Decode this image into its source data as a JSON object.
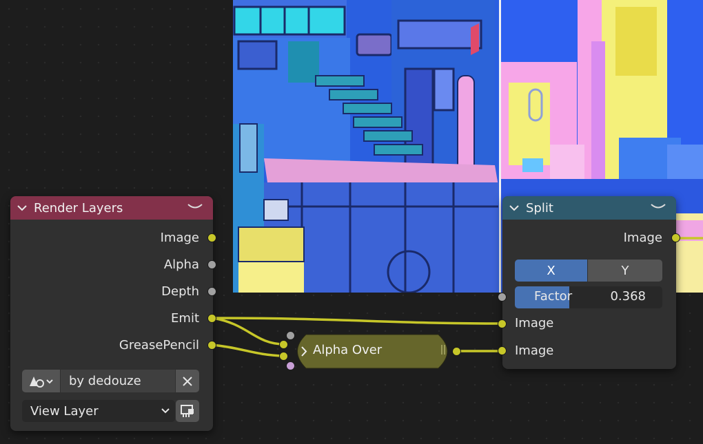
{
  "nodes": {
    "render_layers": {
      "title": "Render Layers",
      "header_color": "#83314a",
      "outputs": [
        "Image",
        "Alpha",
        "Depth",
        "Emit",
        "GreasePencil"
      ],
      "scene_value": "by dedouze",
      "view_layer": "View Layer"
    },
    "alpha_over": {
      "title": "Alpha Over",
      "color": "#66662b"
    },
    "split": {
      "title": "Split",
      "header_color": "#2f5a6d",
      "output": "Image",
      "axis_options": [
        "X",
        "Y"
      ],
      "axis_selected": "X",
      "factor_label": "Factor",
      "factor_value": "0.368",
      "factor_fraction": 0.368,
      "inputs": [
        "Image",
        "Image"
      ]
    }
  },
  "colors": {
    "accent_blue": "#4772b3",
    "wire_yellow": "#c7c729"
  },
  "icons": {
    "collapse": "collapse-arrow-icon",
    "scene": "scene-icon",
    "clear": "close-icon",
    "render_pass": "render-pass-icon"
  }
}
